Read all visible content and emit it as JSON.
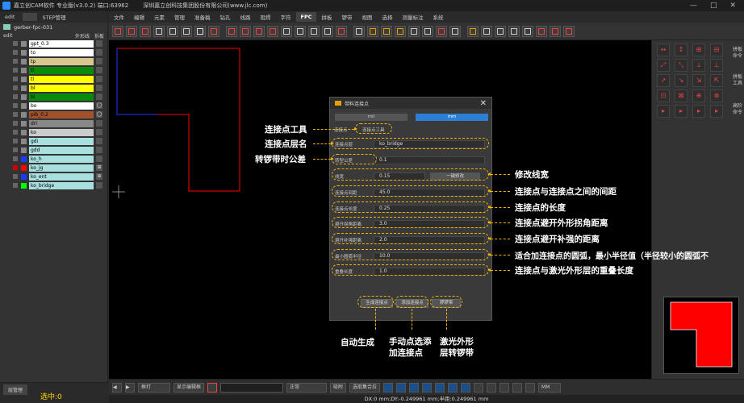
{
  "titlebar": {
    "app": "嘉立创CAM软件 专业版(v3.0.2) 端口:63962",
    "company": "深圳嘉立创科技集团股份有限公司(www.jlc.com)",
    "minimize": "—",
    "maximize": "□",
    "close": "✕"
  },
  "left": {
    "tabs": [
      "edit",
      "",
      "STEP管理"
    ],
    "project": "gerber-fpc-031",
    "header": {
      "name": "edit",
      "outline": "外形线",
      "cut": "拆板"
    },
    "layers": [
      {
        "name": "gpt_0.3",
        "color": "#ffffff",
        "sw": "#888888"
      },
      {
        "name": "to",
        "color": "#ffffff",
        "sw": "#888888"
      },
      {
        "name": "tp",
        "color": "#d8c890",
        "sw": "#888888"
      },
      {
        "name": "tl",
        "color": "#0a8a0a",
        "sw": "#888888"
      },
      {
        "name": "tl",
        "color": "#ffff00",
        "sw": "#888888"
      },
      {
        "name": "bl",
        "color": "#ffff00",
        "sw": "#888888"
      },
      {
        "name": "bl",
        "color": "#0a8a0a",
        "sw": "#888888"
      },
      {
        "name": "bo",
        "color": "#ffffff",
        "sw": "#888888",
        "icon": "◯"
      },
      {
        "name": "pib_0.2",
        "color": "#a0522d",
        "sw": "#888888",
        "icon": "◯"
      },
      {
        "name": "drl",
        "color": "#888888",
        "sw": "#888888"
      },
      {
        "name": "ko",
        "color": "#cccccc",
        "sw": "#888888"
      },
      {
        "name": "gdi",
        "color": "#a8e0e0",
        "sw": "#888888"
      },
      {
        "name": "gdd",
        "color": "#a8e0e0",
        "sw": "#888888"
      },
      {
        "name": "ko_h",
        "color": "#a8e0e0",
        "sw": "#1a3aff"
      },
      {
        "name": "ko_jg",
        "color": "#a8e0e0",
        "sw": "#ff0000",
        "red": true,
        "icon": "⊞"
      },
      {
        "name": "ko_ent",
        "color": "#a8e0e0",
        "sw": "#1a3aff",
        "icon": "⊕"
      },
      {
        "name": "ko_bridge",
        "color": "#a8e0e0",
        "sw": "#00ff00"
      }
    ],
    "layer_manager": "层管理",
    "selected": "选中:0"
  },
  "menu": [
    "文件",
    "编辑",
    "元素",
    "管理",
    "准备稿",
    "钻孔",
    "线路",
    "阻焊",
    "字符",
    "FPC",
    "拼板",
    "锣带",
    "视图",
    "选择",
    "测量标注",
    "系统"
  ],
  "menu_active": "FPC",
  "right": {
    "side1": "拼板命令",
    "side2": "拼板工具",
    "side3": "高阶命令"
  },
  "bottom": {
    "mode": "框打",
    "show_editor": "显示编辑框",
    "normal": "正常",
    "snap": "吸附",
    "select_all": "选取集合拉",
    "unit": "MM"
  },
  "status": "DX:0 mm;DY:-0.249961 mm;半距:0.249961 mm",
  "dialog": {
    "title": "带料连接点",
    "close": "✕",
    "units": [
      "mil",
      "mm"
    ],
    "tab_left": "连接点",
    "tab_right": "连接点工具",
    "layer_label": "连接点层",
    "layer_value": "ko_bridge",
    "rows": [
      {
        "label": "转型公差",
        "value": "0.1"
      },
      {
        "label": "线宽",
        "value": "0.15",
        "extra": "一键修改"
      },
      {
        "label": "连接点间距",
        "value": "45.0"
      },
      {
        "label": "连接点长度",
        "value": "0.25"
      },
      {
        "label": "避开拐角距离",
        "value": "3.0"
      },
      {
        "label": "避开补强距离",
        "value": "2.0"
      },
      {
        "label": "最小圆弧半径",
        "value": "10.0"
      },
      {
        "label": "重叠长度",
        "value": "1.0"
      }
    ],
    "btn_auto": "生成连接点",
    "btn_manual": "添加连接点",
    "btn_laser": "锣锣带"
  },
  "annotations": {
    "tool": "连接点工具",
    "layer": "连接点层名",
    "tol": "转锣带时公差",
    "width": "修改线宽",
    "spacing": "连接点与连接点之间的间距",
    "length": "连接点的长度",
    "corner": "连接点避开外形拐角距离",
    "stiff": "连接点避开补强的距离",
    "arc": "适合加连接点的圆弧，最小半径值（半径较小的圆弧不",
    "overlap": "连接点与激光外形层的重叠长度",
    "auto": "自动生成",
    "manual": "手动点选添加连接点",
    "laser": "激光外形层转锣带"
  }
}
